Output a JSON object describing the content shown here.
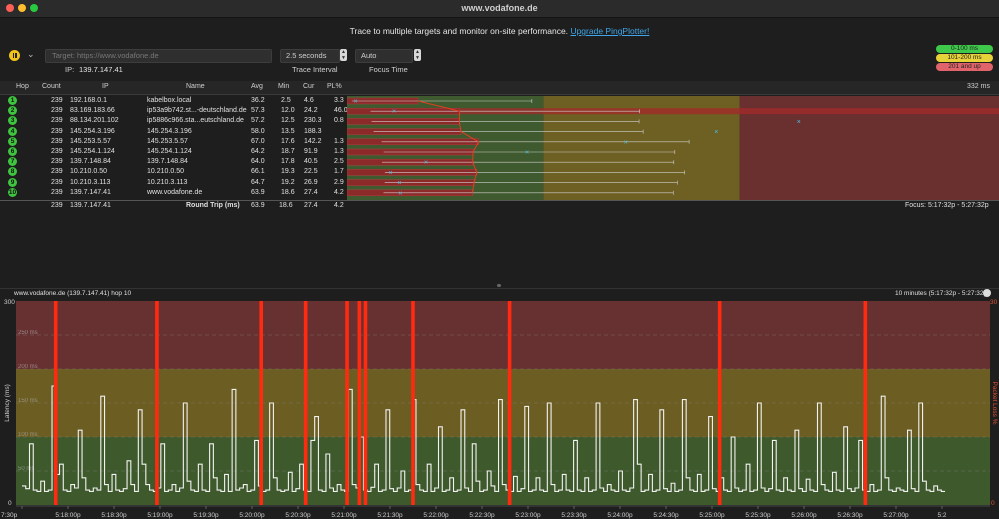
{
  "window": {
    "title": "www.vodafone.de"
  },
  "banner": {
    "text": "Trace to multiple targets and monitor on-site performance.",
    "link": "Upgrade PingPlotter!"
  },
  "toolbar": {
    "target_placeholder": "Target:  https://www.vodafone.de",
    "ip_label": "IP:",
    "ip_value": "139.7.147.41",
    "trace_interval_value": "2.5 seconds",
    "trace_interval_label": "Trace Interval",
    "focus_time_value": "Auto",
    "focus_time_label": "Focus Time"
  },
  "legend": [
    {
      "label": "0-100 ms",
      "color": "#3fc94a"
    },
    {
      "label": "101-200 ms",
      "color": "#e8d23a"
    },
    {
      "label": "201 and up",
      "color": "#e0646a"
    }
  ],
  "table": {
    "headers": {
      "hop": "Hop",
      "count": "Count",
      "ip": "IP",
      "name": "Name",
      "avg": "Avg",
      "min": "Min",
      "cur": "Cur",
      "pl": "PL%"
    },
    "scale_label": "332 ms",
    "rows": [
      {
        "hop": "1",
        "count": "239",
        "ip": "192.168.0.1",
        "name": "kabelbox.local",
        "avg": "36.2",
        "min": "2.5",
        "cur": "4.6",
        "pl": "3.3"
      },
      {
        "hop": "2",
        "count": "239",
        "ip": "83.169.183.66",
        "name": "ip53a9b742.st...-deutschland.de",
        "avg": "57.3",
        "min": "12.0",
        "cur": "24.2",
        "pl": "46.0"
      },
      {
        "hop": "3",
        "count": "239",
        "ip": "88.134.201.102",
        "name": "ip5886c966.sta...eutschland.de",
        "avg": "57.2",
        "min": "12.5",
        "cur": "230.3",
        "pl": "0.8"
      },
      {
        "hop": "4",
        "count": "239",
        "ip": "145.254.3.196",
        "name": "145.254.3.196",
        "avg": "58.0",
        "min": "13.5",
        "cur": "188.3",
        "pl": ""
      },
      {
        "hop": "5",
        "count": "239",
        "ip": "145.253.5.57",
        "name": "145.253.5.57",
        "avg": "67.0",
        "min": "17.6",
        "cur": "142.2",
        "pl": "1.3"
      },
      {
        "hop": "6",
        "count": "239",
        "ip": "145.254.1.124",
        "name": "145.254.1.124",
        "avg": "64.2",
        "min": "18.7",
        "cur": "91.9",
        "pl": "1.3"
      },
      {
        "hop": "7",
        "count": "239",
        "ip": "139.7.148.84",
        "name": "139.7.148.84",
        "avg": "64.0",
        "min": "17.8",
        "cur": "40.5",
        "pl": "2.5"
      },
      {
        "hop": "8",
        "count": "239",
        "ip": "10.210.0.50",
        "name": "10.210.0.50",
        "avg": "66.1",
        "min": "19.3",
        "cur": "22.5",
        "pl": "1.7"
      },
      {
        "hop": "9",
        "count": "239",
        "ip": "10.210.3.113",
        "name": "10.210.3.113",
        "avg": "64.7",
        "min": "19.2",
        "cur": "26.9",
        "pl": "2.9"
      },
      {
        "hop": "10",
        "count": "239",
        "ip": "139.7.147.41",
        "name": "www.vodafone.de",
        "avg": "63.9",
        "min": "18.6",
        "cur": "27.4",
        "pl": "4.2"
      }
    ],
    "summary": {
      "count": "239",
      "ip": "139.7.147.41",
      "label": "Round Trip (ms)",
      "avg": "63.9",
      "min": "18.6",
      "cur": "27.4",
      "pl": "4.2",
      "focus": "Focus: 5:17:32p - 5:27:32p"
    }
  },
  "graph": {
    "title": "www.vodafone.de (139.7.147.41) hop 10",
    "range_label": "10 minutes (5:17:32p - 5:27:32p)",
    "y_axis_label": "Latency (ms)",
    "y2_axis_label": "Packet Loss %",
    "y_ticks": [
      "300",
      "0"
    ],
    "y2_ticks": [
      "30",
      "0"
    ],
    "grid_labels": [
      "250 ms",
      "200 ms",
      "150 ms",
      "100 ms",
      "50 ms"
    ],
    "x_ticks": [
      "7:30p",
      "5:18:00p",
      "5:18:30p",
      "5:19:00p",
      "5:19:30p",
      "5:20:00p",
      "5:20:30p",
      "5:21:00p",
      "5:21:30p",
      "5:22:00p",
      "5:22:30p",
      "5:23:00p",
      "5:23:30p",
      "5:24:00p",
      "5:24:30p",
      "5:25:00p",
      "5:25:30p",
      "5:26:00p",
      "5:26:30p",
      "5:27:00p",
      "5:2"
    ],
    "zone_colors": {
      "good": "#3f5a2e",
      "warn": "#6e5f22",
      "bad": "#6a3030"
    },
    "loss_color": "#ff2a10"
  },
  "chart_data": {
    "type": "line",
    "title": "www.vodafone.de (139.7.147.41) hop 10",
    "xlabel": "",
    "ylabel": "Latency (ms)",
    "ylim": [
      0,
      300
    ],
    "y2label": "Packet Loss %",
    "y2lim": [
      0,
      30
    ],
    "x_range": [
      "5:17:30p",
      "5:27:32p"
    ],
    "latency_series": {
      "name": "Latency",
      "values": [
        28,
        24,
        90,
        22,
        20,
        35,
        20,
        22,
        175,
        45,
        60,
        22,
        20,
        30,
        25,
        110,
        40,
        22,
        20,
        25,
        22,
        160,
        30,
        20,
        45,
        22,
        20,
        24,
        65,
        30,
        20,
        140,
        60,
        30,
        22,
        20,
        25,
        90,
        20,
        22,
        30,
        20,
        25,
        150,
        35,
        22,
        20,
        60,
        22,
        20,
        90,
        40,
        22,
        20,
        45,
        20,
        170,
        22,
        25,
        30,
        20,
        22,
        95,
        28,
        20,
        22,
        150,
        40,
        22,
        20,
        22,
        48,
        20,
        24,
        60,
        22,
        20,
        95,
        130,
        22,
        20,
        75,
        25,
        20,
        30,
        22,
        20,
        170,
        30,
        25,
        100,
        22,
        20,
        26,
        60,
        20,
        22,
        140,
        24,
        20,
        25,
        50,
        20,
        22,
        155,
        30,
        22,
        20,
        60,
        20,
        25,
        115,
        20,
        22,
        40,
        20,
        22,
        140,
        25,
        20,
        90,
        35,
        20,
        22,
        50,
        28,
        20,
        155,
        30,
        22,
        20,
        42,
        20,
        24,
        145,
        20,
        22,
        40,
        22,
        20,
        150,
        30,
        20,
        22,
        45,
        22,
        20,
        95,
        22,
        20,
        40,
        20,
        22,
        150,
        25,
        20,
        30,
        22,
        20,
        50,
        22,
        20,
        25,
        155,
        60,
        20,
        22,
        45,
        20,
        22,
        140,
        24,
        20,
        32,
        20,
        22,
        155,
        40,
        22,
        20,
        45,
        20,
        22,
        130,
        24,
        20,
        40,
        22,
        20,
        100,
        25,
        20,
        22,
        60,
        20,
        22,
        150,
        25,
        20,
        24,
        95,
        22,
        20,
        40,
        22,
        20,
        110,
        24,
        20,
        38,
        22,
        20,
        150,
        30,
        22,
        20,
        48,
        22,
        20,
        115,
        24,
        20,
        25,
        95,
        22,
        20,
        30,
        20,
        22,
        160,
        40,
        22,
        20,
        25,
        22,
        20,
        110,
        24,
        20,
        150,
        35,
        22,
        20,
        28,
        22,
        20
      ]
    },
    "packet_loss_times": [
      "5:17:52p",
      "5:18:58p",
      "5:20:06p",
      "5:20:35p",
      "5:21:02p",
      "5:21:10p",
      "5:21:14p",
      "5:21:45p",
      "5:22:48p",
      "5:25:05p",
      "5:26:40p"
    ]
  }
}
